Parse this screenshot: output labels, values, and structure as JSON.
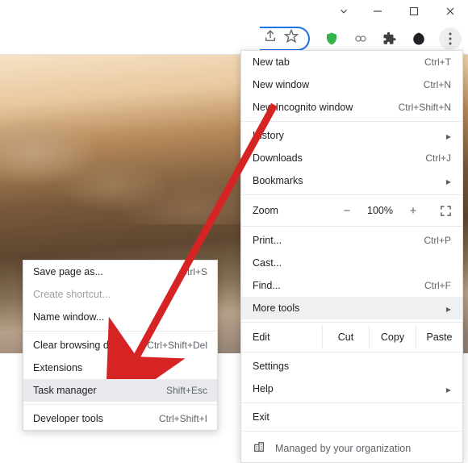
{
  "menu": {
    "new_tab": {
      "label": "New tab",
      "shortcut": "Ctrl+T"
    },
    "new_window": {
      "label": "New window",
      "shortcut": "Ctrl+N"
    },
    "new_incognito": {
      "label": "New Incognito window",
      "shortcut": "Ctrl+Shift+N"
    },
    "history": {
      "label": "History"
    },
    "downloads": {
      "label": "Downloads",
      "shortcut": "Ctrl+J"
    },
    "bookmarks": {
      "label": "Bookmarks"
    },
    "zoom": {
      "label": "Zoom",
      "minus": "−",
      "pct": "100%",
      "plus": "+"
    },
    "print": {
      "label": "Print...",
      "shortcut": "Ctrl+P"
    },
    "cast": {
      "label": "Cast..."
    },
    "find": {
      "label": "Find...",
      "shortcut": "Ctrl+F"
    },
    "more_tools": {
      "label": "More tools"
    },
    "edit": {
      "label": "Edit",
      "cut": "Cut",
      "copy": "Copy",
      "paste": "Paste"
    },
    "settings": {
      "label": "Settings"
    },
    "help": {
      "label": "Help"
    },
    "exit": {
      "label": "Exit"
    },
    "managed": {
      "label": "Managed by your organization"
    }
  },
  "submenu": {
    "save_page": {
      "label": "Save page as...",
      "shortcut": "Ctrl+S"
    },
    "create_shortcut": {
      "label": "Create shortcut..."
    },
    "name_window": {
      "label": "Name window..."
    },
    "clear_data": {
      "label": "Clear browsing data...",
      "shortcut": "Ctrl+Shift+Del"
    },
    "extensions": {
      "label": "Extensions"
    },
    "task_manager": {
      "label": "Task manager",
      "shortcut": "Shift+Esc"
    },
    "dev_tools": {
      "label": "Developer tools",
      "shortcut": "Ctrl+Shift+I"
    }
  }
}
